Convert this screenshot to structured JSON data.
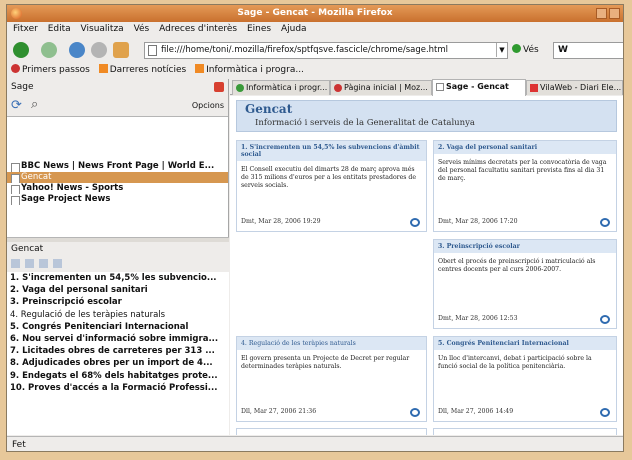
{
  "window": {
    "title": "Sage - Gencat - Mozilla Firefox"
  },
  "menu": [
    "Fitxer",
    "Edita",
    "Visualitza",
    "Vés",
    "Adreces d'interès",
    "Eines",
    "Ajuda"
  ],
  "navbar": {
    "url": "file:///home/toni/.mozilla/firefox/sptfqsve.fascicle/chrome/sage.html",
    "go_label": "Vés",
    "search_value": "W"
  },
  "bookmarks": [
    "Primers passos",
    "Darreres notícies",
    "Informàtica i progra..."
  ],
  "sidebar": {
    "title": "Sage",
    "options_label": "Opcions",
    "feeds": [
      "BBC News | News Front Page | World E...",
      "Gencat",
      "Yahoo! News - Sports",
      "Sage Project News"
    ],
    "selected_feed": "Gencat",
    "items": [
      "1. S'incrementen un 54,5% les subvencio...",
      "2. Vaga del personal sanitari",
      "3. Preinscripció escolar",
      "4. Regulació de les teràpies naturals",
      "5. Congrés Penitenciari Internacional",
      "6. Nou servei d'informació sobre immigra...",
      "7. Licitades obres de carreteres per 313 ...",
      "8. Adjudicades obres per un import de 4...",
      "9. Endegats el 68% dels habitatges prote...",
      "10. Proves d'accés a la Formació Professi..."
    ]
  },
  "tabs": [
    "Informàtica i progr...",
    "Pàgina inicial | Moz...",
    "Sage - Gencat",
    "VilaWeb - Diari Ele..."
  ],
  "page": {
    "title": "Gencat",
    "subtitle": "Informació i serveis de la Generalitat de Catalunya",
    "cards": [
      {
        "title": "1. S'incrementen un 54,5% les subvencions d'àmbit social",
        "desc": "El Consell executiu del dimarts 28 de març aprova més de 315 milions d'euros per a les entitats prestadores de serveis socials.",
        "date": "Dmt, Mar 28, 2006 19:29"
      },
      {
        "title": "2. Vaga del personal sanitari",
        "desc": "Serveis mínims decretats per la convocatòria de vaga del personal facultatiu sanitari prevista fins al dia 31 de març.",
        "date": "Dmt, Mar 28, 2006 17:20"
      },
      {
        "title": "3. Preinscripció escolar",
        "desc": "Obert el procés de preinscripció i matriculació als centres docents per al curs 2006-2007.",
        "date": "Dmt, Mar 28, 2006 12:53"
      },
      {
        "title": "4. Regulació de les teràpies naturals",
        "desc": "El govern presenta un Projecte de Decret per regular determinades teràpies naturals.",
        "date": "Dll, Mar 27, 2006 21:36"
      },
      {
        "title": "5. Congrés Penitenciari Internacional",
        "desc": "Un lloc d'intercanvi, debat i participació sobre la funció social de la política penitenciària.",
        "date": "Dll, Mar 27, 2006 14:49"
      }
    ]
  },
  "status": "Fet",
  "colors": {
    "accent": "#d69750",
    "titlebar": "#c9702e",
    "card_header": "#dce7f4",
    "link_blue": "#2f5a8f"
  }
}
